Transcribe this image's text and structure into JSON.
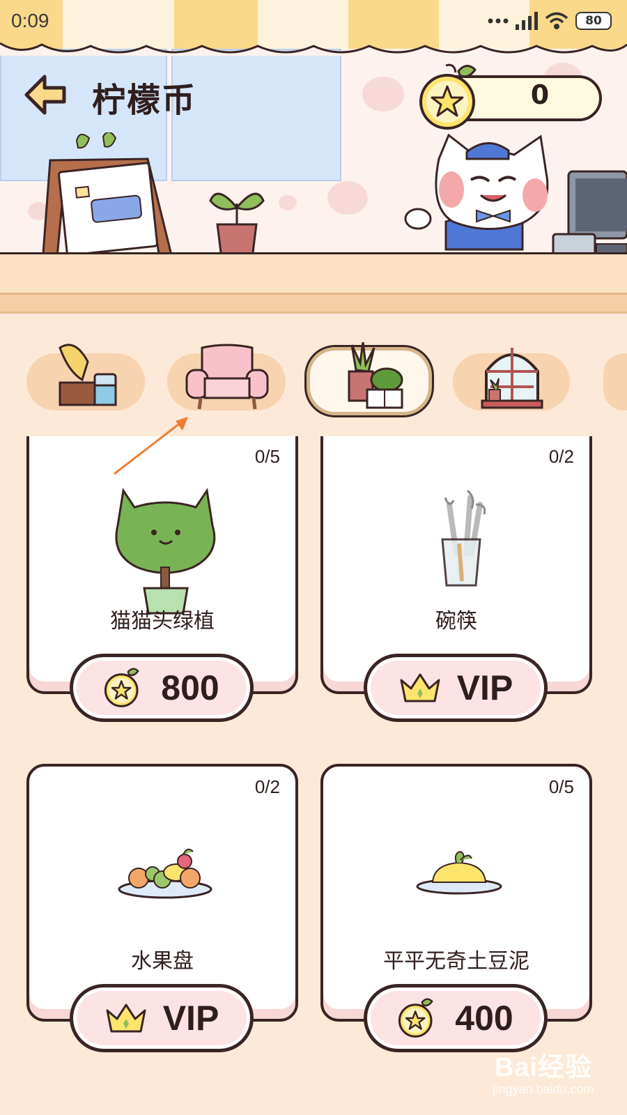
{
  "status_bar": {
    "time": "0:09",
    "battery": "80"
  },
  "header": {
    "title": "柠檬币",
    "balance": "0"
  },
  "tabs": [
    {
      "icon": "gramophone-icon",
      "active": false
    },
    {
      "icon": "armchair-icon",
      "active": false
    },
    {
      "icon": "plant-book-icon",
      "active": true
    },
    {
      "icon": "window-icon",
      "active": false
    }
  ],
  "items": [
    {
      "name": "猫猫头绿植",
      "count": "0/5",
      "price": "800",
      "currency": "lemon-coin-icon",
      "icon": "cat-tree-icon"
    },
    {
      "name": "碗筷",
      "count": "0/2",
      "price": "VIP",
      "currency": "crown-icon",
      "icon": "utensils-icon"
    },
    {
      "name": "水果盘",
      "count": "0/2",
      "price": "VIP",
      "currency": "crown-icon",
      "icon": "fruit-plate-icon"
    },
    {
      "name": "平平无奇土豆泥",
      "count": "0/5",
      "price": "400",
      "currency": "lemon-coin-icon",
      "icon": "mashed-potato-icon"
    }
  ],
  "watermark": {
    "main": "Bai经验",
    "sub": "jingyan.baidu.com"
  },
  "colors": {
    "outline": "#3a2424",
    "background": "#fde9d7",
    "card_shadow": "#f9d7d7",
    "tab": "#f8d3b0"
  }
}
